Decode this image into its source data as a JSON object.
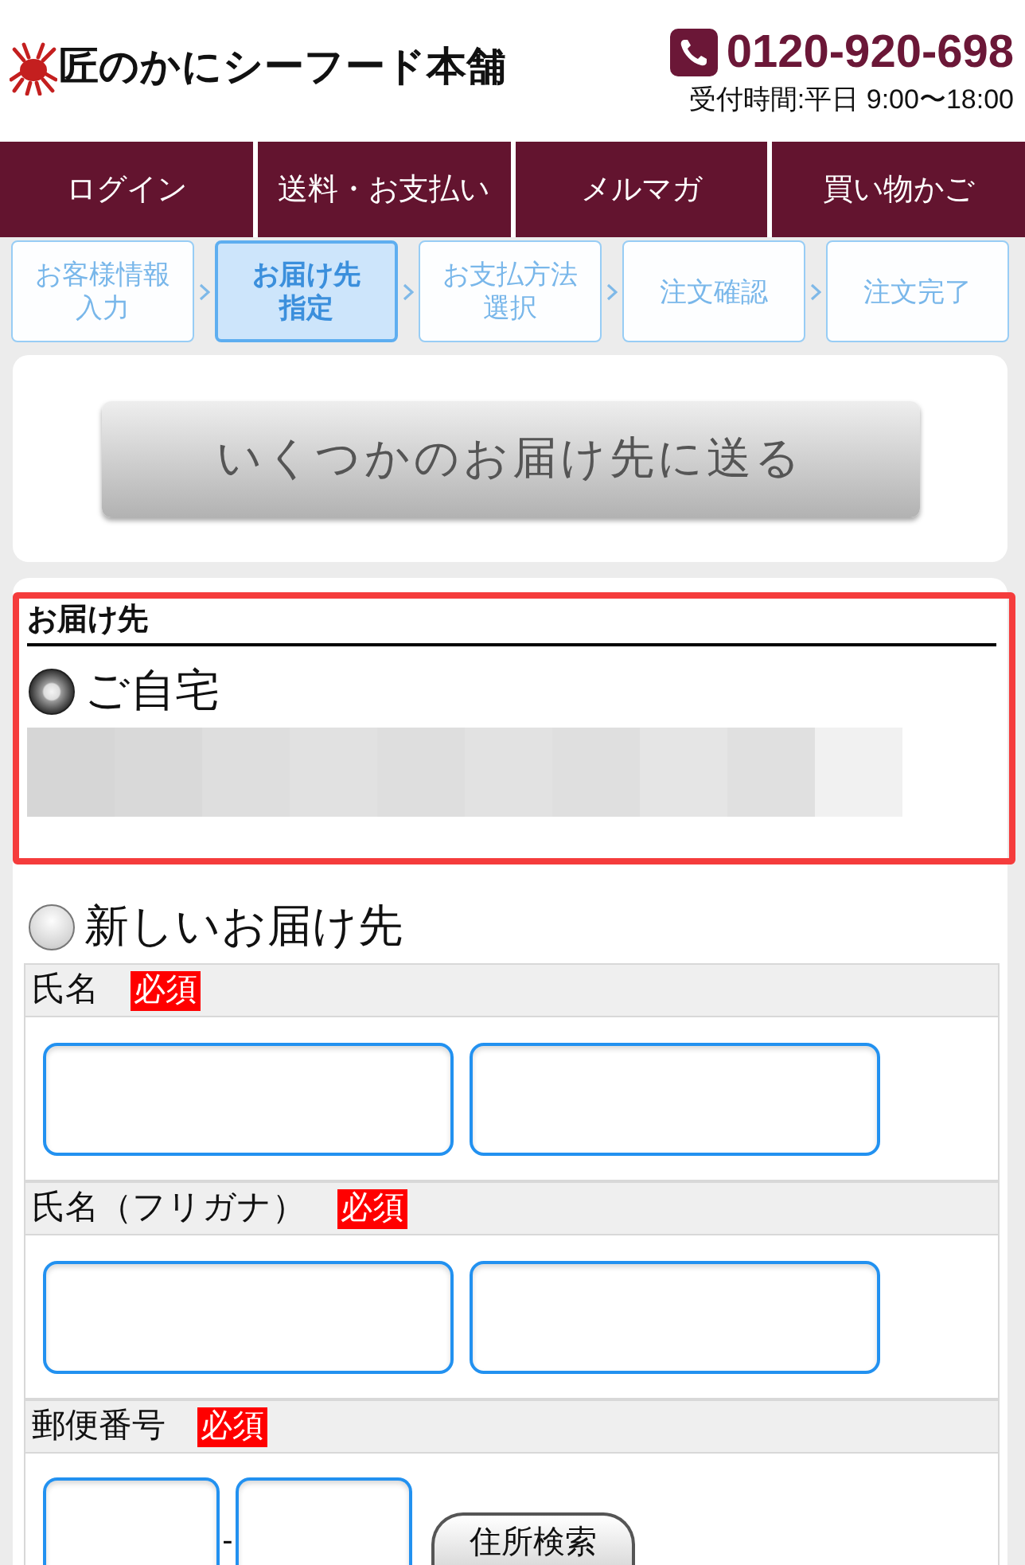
{
  "header": {
    "logo": "匠のかにシーフード本舗",
    "phone": "0120-920-698",
    "hours": "受付時間:平日 9:00〜18:00"
  },
  "nav": [
    {
      "label": "ログイン"
    },
    {
      "label": "送料・お支払い"
    },
    {
      "label": "メルマガ"
    },
    {
      "label": "買い物かご"
    }
  ],
  "steps": [
    {
      "label": "お客様情報入力",
      "selected": false
    },
    {
      "label": "お届け先指定",
      "selected": true
    },
    {
      "label": "お支払方法選択",
      "selected": false
    },
    {
      "label": "注文確認",
      "selected": false
    },
    {
      "label": "注文完了",
      "selected": false
    }
  ],
  "multi_ship_button": "いくつかのお届け先に送る",
  "destination": {
    "heading": "お届け先",
    "options": [
      {
        "kind": "saved",
        "label": "ご自宅",
        "selected": true
      },
      {
        "kind": "new",
        "label": "新しいお届け先",
        "selected": false
      }
    ]
  },
  "form": {
    "fields": [
      {
        "kind": "pair",
        "label": "氏名",
        "badge": "必須"
      },
      {
        "kind": "pair",
        "label": "氏名（フリガナ）",
        "badge": "必須"
      },
      {
        "kind": "postal",
        "label": "郵便番号",
        "badge": "必須",
        "separator": "-",
        "button": "住所検索"
      }
    ]
  }
}
